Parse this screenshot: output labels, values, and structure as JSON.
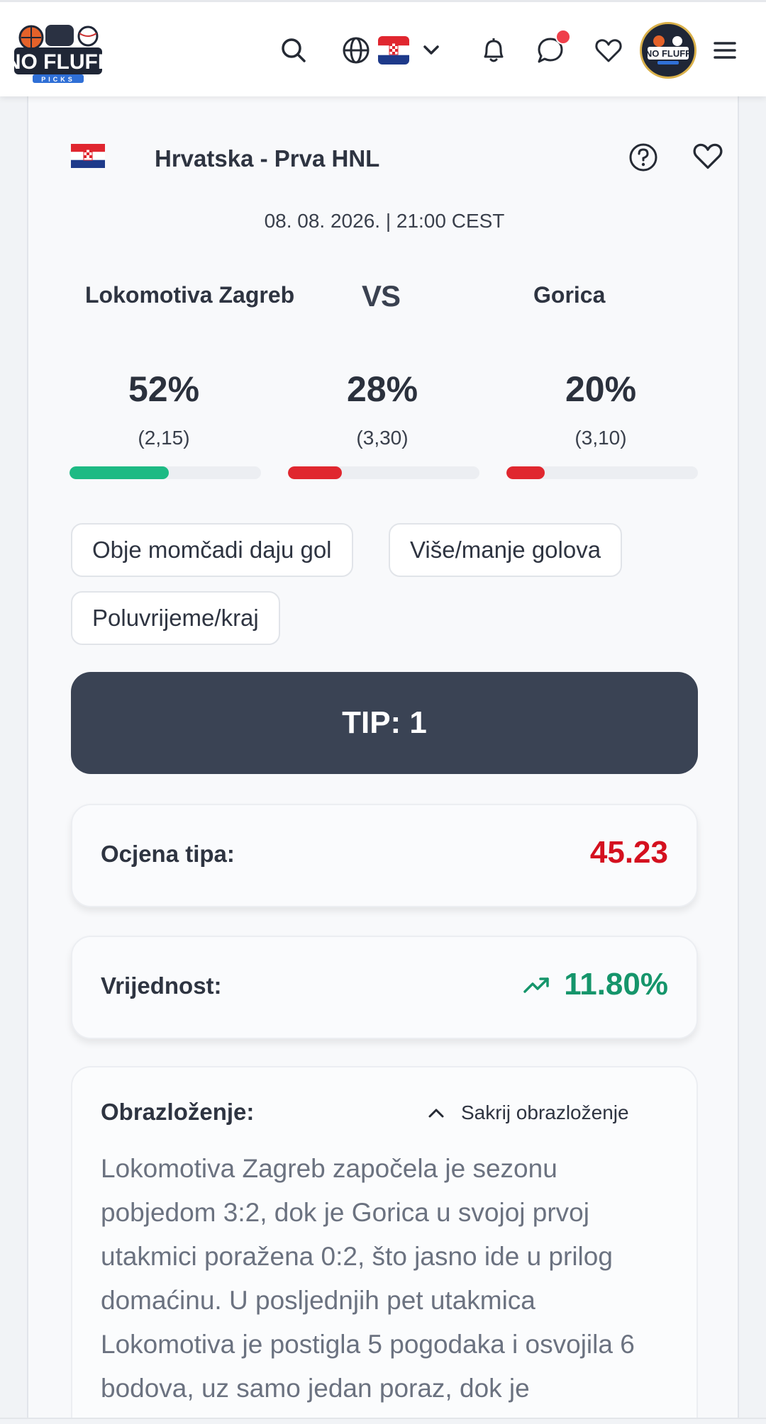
{
  "header": {
    "logo_text": "NO FLUFF",
    "logo_sub": "PICKS"
  },
  "colors": {
    "home_bar": "#1dba84",
    "draw_bar": "#e0272f",
    "away_bar": "#e0272f",
    "rating_value": "#d4101f",
    "value_green": "#15956b",
    "tip_bg": "#3a4354"
  },
  "match": {
    "league": "Hrvatska - Prva HNL",
    "datetime": "08. 08. 2026. | 21:00 CEST",
    "home_team": "Lokomotiva Zagreb",
    "vs_label": "VS",
    "away_team": "Gorica",
    "outcomes": [
      {
        "prob_label": "52%",
        "odds": "(2,15)",
        "bar_fraction": 0.52
      },
      {
        "prob_label": "28%",
        "odds": "(3,30)",
        "bar_fraction": 0.28
      },
      {
        "prob_label": "20%",
        "odds": "(3,10)",
        "bar_fraction": 0.2
      }
    ]
  },
  "markets": [
    "Obje momčadi daju gol",
    "Više/manje golova",
    "Poluvrijeme/kraj"
  ],
  "tip": {
    "label": "TIP: 1"
  },
  "rating": {
    "label": "Ocjena tipa:",
    "value": "45.23"
  },
  "value": {
    "label": "Vrijednost:",
    "value": "11.80%",
    "icon": "trending-up-icon"
  },
  "reasoning": {
    "title": "Obrazloženje:",
    "toggle_label": "Sakrij obrazloženje",
    "text": "Lokomotiva Zagreb započela je sezonu pobjedom 3:2, dok je Gorica u svojoj prvoj utakmici poražena 0:2, što jasno ide u prilog domaćinu. U posljednjih pet utakmica Lokomotiva je postigla 5 pogodaka i osvojila 6 bodova, uz samo jedan poraz, dok je"
  }
}
